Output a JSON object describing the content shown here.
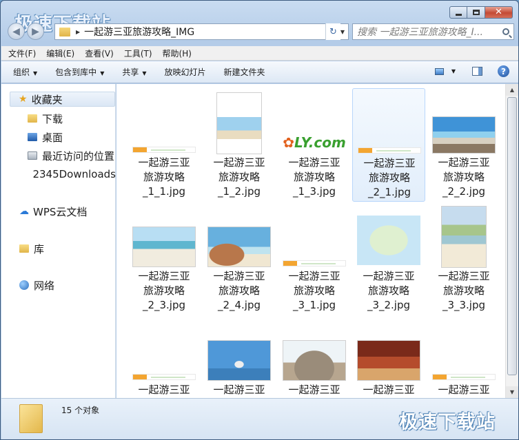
{
  "watermark_text": "极速下载站",
  "window_controls": {
    "minimize": "",
    "maximize": "",
    "close": "✕"
  },
  "address": {
    "path": "一起游三亚旅游攻略_IMG"
  },
  "search": {
    "placeholder": "搜索 一起游三亚旅游攻略_I..."
  },
  "menubar": [
    "文件(F)",
    "编辑(E)",
    "查看(V)",
    "工具(T)",
    "帮助(H)"
  ],
  "toolbar": {
    "organize": "组织",
    "include_library": "包含到库中",
    "share": "共享",
    "slideshow": "放映幻灯片",
    "new_folder": "新建文件夹"
  },
  "navpane": {
    "favorites": "收藏夹",
    "items": [
      "下载",
      "桌面",
      "最近访问的位置",
      "2345Downloads"
    ],
    "wps": "WPS云文档",
    "library": "库",
    "network": "网络"
  },
  "files": [
    {
      "name": "一起游三亚旅游攻略_1_1.jpg",
      "line1": "一起游三亚",
      "line2": "旅游攻略",
      "line3": "_1_1.jpg",
      "thumb": "banner"
    },
    {
      "name": "一起游三亚旅游攻略_1_2.jpg",
      "line1": "一起游三亚",
      "line2": "旅游攻略",
      "line3": "_1_2.jpg",
      "thumb": "cover"
    },
    {
      "name": "一起游三亚旅游攻略_1_3.jpg",
      "line1": "一起游三亚",
      "line2": "旅游攻略",
      "line3": "_1_3.jpg",
      "thumb": "logo"
    },
    {
      "name": "一起游三亚旅游攻略_2_1.jpg",
      "line1": "一起游三亚",
      "line2": "旅游攻略",
      "line3": "_2_1.jpg",
      "thumb": "banner",
      "selected": true
    },
    {
      "name": "一起游三亚旅游攻略_2_2.jpg",
      "line1": "一起游三亚",
      "line2": "旅游攻略",
      "line3": "_2_2.jpg",
      "thumb": "beach1"
    },
    {
      "name": "一起游三亚旅游攻略_2_3.jpg",
      "line1": "一起游三亚",
      "line2": "旅游攻略",
      "line3": "_2_3.jpg",
      "thumb": "beach2"
    },
    {
      "name": "一起游三亚旅游攻略_2_4.jpg",
      "line1": "一起游三亚",
      "line2": "旅游攻略",
      "line3": "_2_4.jpg",
      "thumb": "rock"
    },
    {
      "name": "一起游三亚旅游攻略_3_1.jpg",
      "line1": "一起游三亚",
      "line2": "旅游攻略",
      "line3": "_3_1.jpg",
      "thumb": "banner"
    },
    {
      "name": "一起游三亚旅游攻略_3_2.jpg",
      "line1": "一起游三亚",
      "line2": "旅游攻略",
      "line3": "_3_2.jpg",
      "thumb": "map"
    },
    {
      "name": "一起游三亚旅游攻略_3_3.jpg",
      "line1": "一起游三亚",
      "line2": "旅游攻略",
      "line3": "_3_3.jpg",
      "thumb": "palm"
    },
    {
      "name": "一起游三亚",
      "line1": "一起游三亚",
      "line2": "",
      "line3": "",
      "thumb": "banner"
    },
    {
      "name": "一起游三亚",
      "line1": "一起游三亚",
      "line2": "",
      "line3": "",
      "thumb": "statue"
    },
    {
      "name": "一起游三亚",
      "line1": "一起游三亚",
      "line2": "",
      "line3": "",
      "thumb": "stone"
    },
    {
      "name": "一起游三亚",
      "line1": "一起游三亚",
      "line2": "",
      "line3": "",
      "thumb": "dance"
    },
    {
      "name": "一起游三亚",
      "line1": "一起游三亚",
      "line2": "",
      "line3": "",
      "thumb": "banner"
    }
  ],
  "status": {
    "count": "15 个对象"
  },
  "colors": {
    "accent": "#3e6aa5",
    "selection": "#e2eefb",
    "window_frame": "#b9cfe8"
  }
}
